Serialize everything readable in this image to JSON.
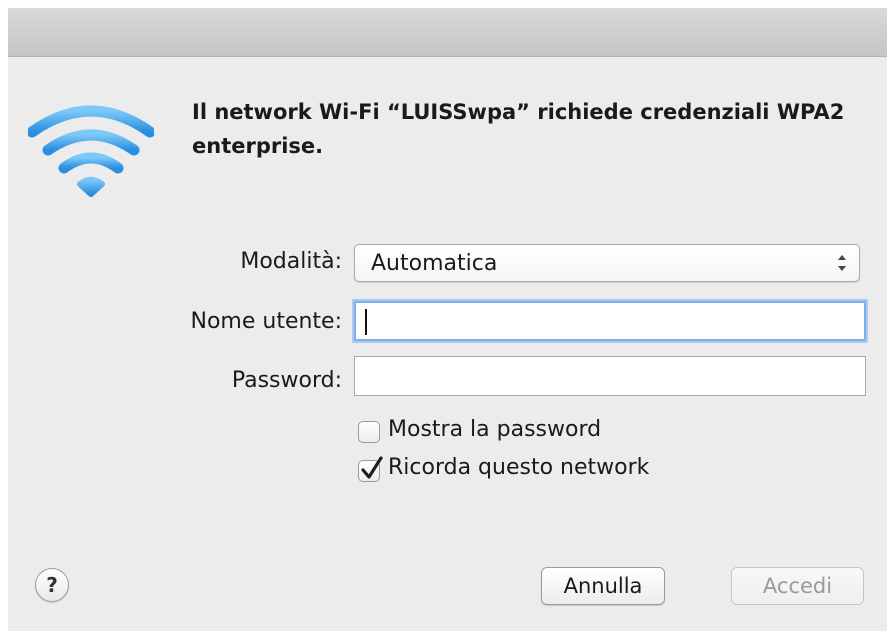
{
  "dialog": {
    "message": "Il network Wi-Fi “LUISSwpa” richiede credenziali WPA2 enterprise.",
    "icon": "wifi-icon"
  },
  "form": {
    "mode_label": "Modalità:",
    "mode_value": "Automatica",
    "username_label": "Nome utente:",
    "username_value": "",
    "password_label": "Password:",
    "password_value": ""
  },
  "options": {
    "show_password_label": "Mostra la password",
    "show_password_checked": false,
    "remember_label": "Ricorda questo network",
    "remember_checked": true
  },
  "buttons": {
    "help": "?",
    "cancel": "Annulla",
    "login": "Accedi"
  },
  "colors": {
    "wifi_blue": "#3a9be6",
    "focus_ring": "#7fb0ec",
    "disabled_text": "#9a9a9a"
  }
}
